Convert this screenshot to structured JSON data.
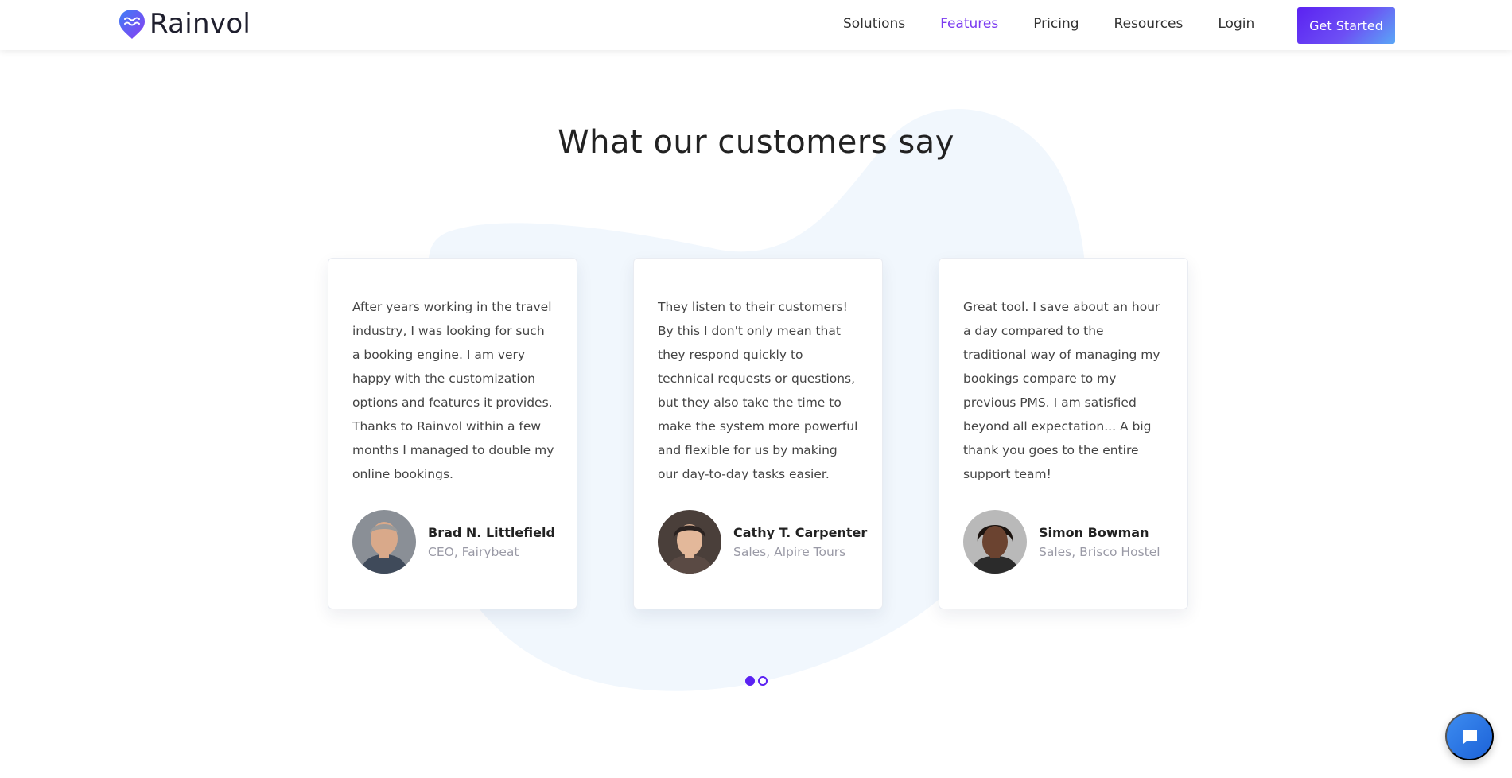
{
  "brand": {
    "name": "Rainvol"
  },
  "nav": {
    "items": [
      {
        "label": "Solutions",
        "active": false
      },
      {
        "label": "Features",
        "active": true
      },
      {
        "label": "Pricing",
        "active": false
      },
      {
        "label": "Resources",
        "active": false
      },
      {
        "label": "Login",
        "active": false
      }
    ],
    "cta_label": "Get Started"
  },
  "section": {
    "title": "What our customers say"
  },
  "testimonials": [
    {
      "quote": "After years working in the travel industry, I was looking for such a booking engine. I am very happy with the customization options and features it provides. Thanks to Rainvol within a few months I managed to double my online bookings.",
      "name": "Brad N. Littlefield",
      "role": "CEO, Fairybeat"
    },
    {
      "quote": "They listen to their customers! By this I don't only mean that they respond quickly to technical requests or questions, but they also take the time to make the system more powerful and flexible for us by making our day-to-day tasks easier.",
      "name": "Cathy T. Carpenter",
      "role": "Sales, Alpire Tours"
    },
    {
      "quote": "Great tool. I save about an hour a day compared to the traditional way of managing my bookings compare to my previous PMS. I am satisfied beyond all expectation... A big thank you goes to the entire support team!",
      "name": "Simon Bowman",
      "role": "Sales, Brisco Hostel"
    }
  ],
  "pagination": {
    "pages": 2,
    "current": 1
  },
  "colors": {
    "accent": "#7b3bf0",
    "button": "#5b22f2",
    "blob": "#f0f6fd",
    "chat": "#2a74e4"
  },
  "icons": {
    "logo": "raindrop-logo-icon",
    "chat": "chat-bubble-icon"
  }
}
